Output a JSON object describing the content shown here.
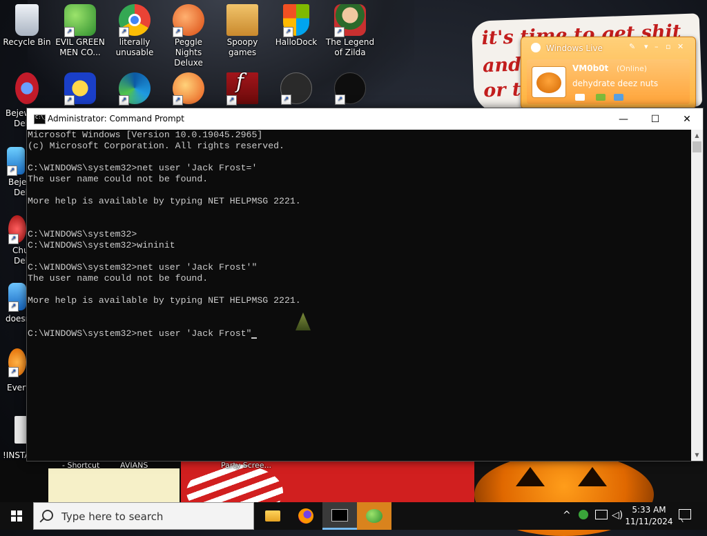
{
  "desktop": {
    "icons": [
      {
        "label": "Recycle Bin",
        "icon": "recycle-bin-icon",
        "color": "#d8dde5"
      },
      {
        "label": "EVIL GREEN MEN CO...",
        "icon": "messenger-buddies-icon",
        "color": "#3aa53a"
      },
      {
        "label": "literally unusable",
        "icon": "chrome-icon",
        "color": "#ea4335"
      },
      {
        "label": "Peggle Nights Deluxe",
        "icon": "peggle-icon",
        "color": "#e8581a"
      },
      {
        "label": "Spoopy games",
        "icon": "folder-icon",
        "color": "#d9a441"
      },
      {
        "label": "HalloDock",
        "icon": "windows-shield-icon",
        "color": "#f35325"
      },
      {
        "label": "The Legend of Zilda",
        "icon": "zelda-character-icon",
        "color": "#3c8a3c"
      }
    ],
    "row2_icons": [
      {
        "icon": "bejeweled-icon",
        "color": "#c21b2a"
      },
      {
        "icon": "mpl-icon",
        "color": "#1a3fc8"
      },
      {
        "icon": "edge-icon",
        "color": "#1f9ae0"
      },
      {
        "icon": "popcap-icon",
        "color": "#e8581a"
      },
      {
        "icon": "flash-icon",
        "color": "#7a0a0a"
      },
      {
        "icon": "network-admin-icon",
        "color": "#222222"
      },
      {
        "icon": "yashma-icon",
        "color": "#111111"
      }
    ],
    "left_partials": [
      "Bejew",
      "Del",
      "Bejew",
      "Del",
      "Chu",
      "Del",
      "doesn",
      "Every",
      "!INSTA"
    ],
    "bottom_captions": [
      "- Shortcut",
      "AVIANS",
      "Party Scree..."
    ],
    "wallpaper_text": [
      "it's time to get shit",
      "and",
      "or t"
    ]
  },
  "messenger": {
    "title": "Windows Live",
    "username": "VM0b0t",
    "status": "(Online)",
    "personal_message": "dehydrate deez nuts"
  },
  "cmd": {
    "title": "Administrator: Command Prompt",
    "lines": [
      "Microsoft Windows [Version 10.0.19045.2965]",
      "(c) Microsoft Corporation. All rights reserved.",
      "",
      "C:\\WINDOWS\\system32>net user 'Jack Frost='",
      "The user name could not be found.",
      "",
      "More help is available by typing NET HELPMSG 2221.",
      "",
      "",
      "C:\\WINDOWS\\system32>",
      "C:\\WINDOWS\\system32>wininit",
      "",
      "C:\\WINDOWS\\system32>net user 'Jack Frost'\"",
      "The user name could not be found.",
      "",
      "More help is available by typing NET HELPMSG 2221.",
      "",
      "",
      "C:\\WINDOWS\\system32>net user 'Jack Frost\""
    ],
    "background": "#0c0c0c",
    "foreground": "#cccccc"
  },
  "taskbar": {
    "search_placeholder": "Type here to search",
    "apps": [
      "file-explorer-icon",
      "firefox-icon",
      "command-prompt-icon",
      "messenger-icon"
    ],
    "time": "5:33 AM",
    "date": "11/11/2024"
  }
}
